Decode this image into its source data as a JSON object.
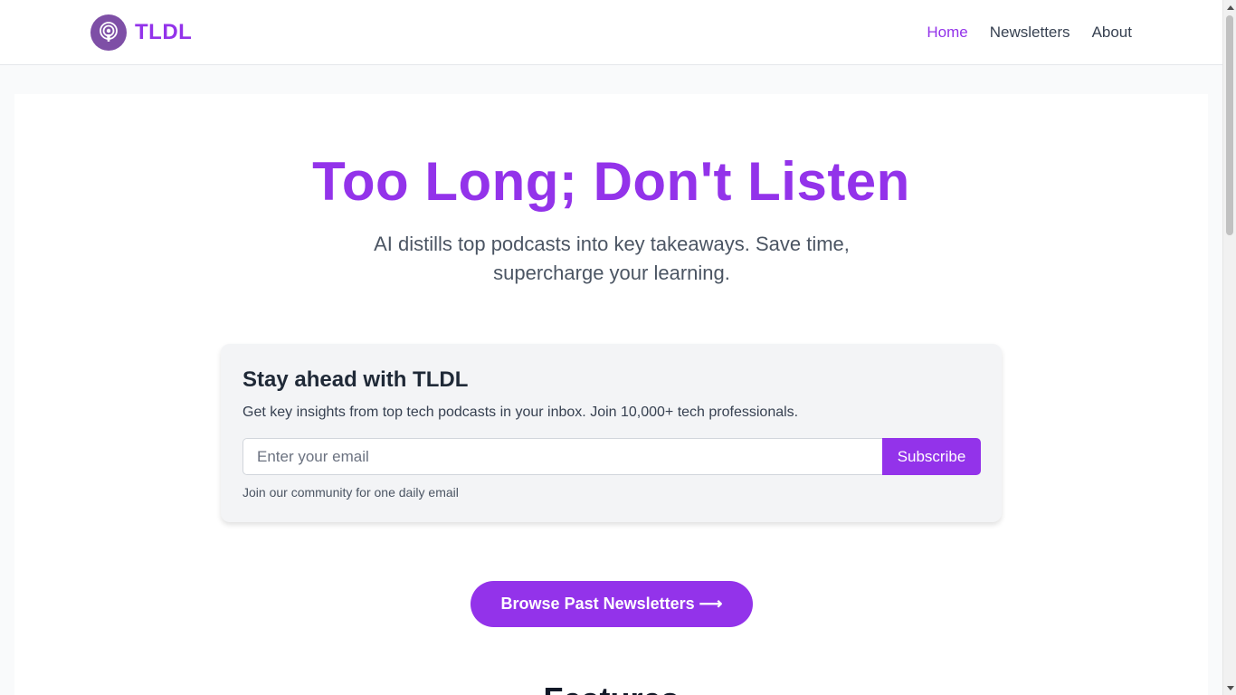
{
  "brand": {
    "name": "TLDL",
    "icon": "podcast-icon",
    "accent": "#9333ea"
  },
  "nav": {
    "items": [
      {
        "label": "Home",
        "active": true
      },
      {
        "label": "Newsletters",
        "active": false
      },
      {
        "label": "About",
        "active": false
      }
    ]
  },
  "hero": {
    "title": "Too Long; Don't Listen",
    "subtitle": "AI distills top podcasts into key takeaways. Save time, supercharge your learning."
  },
  "subscribe": {
    "title": "Stay ahead with TLDL",
    "description": "Get key insights from top tech podcasts in your inbox. Join 10,000+ tech professionals.",
    "email_placeholder": "Enter your email",
    "email_value": "",
    "button_label": "Subscribe",
    "note": "Join our community for one daily email"
  },
  "browse": {
    "label": "Browse Past Newsletters ⟶"
  },
  "features": {
    "heading": "Features"
  }
}
